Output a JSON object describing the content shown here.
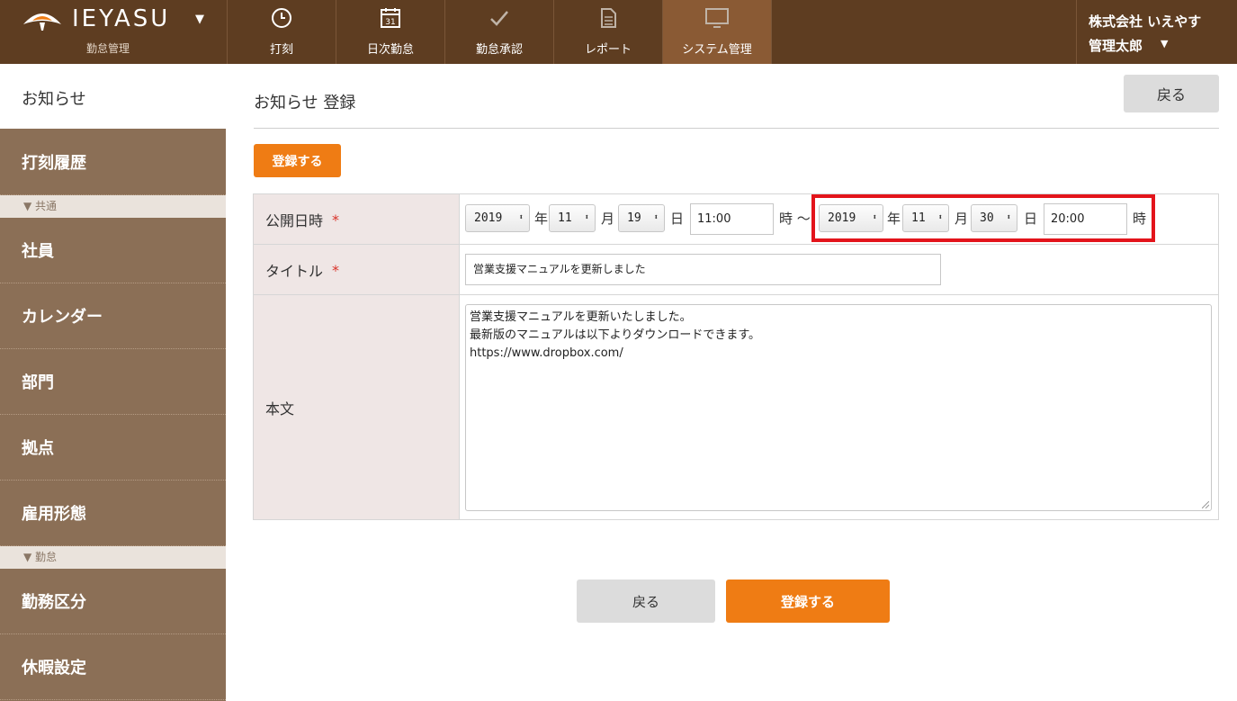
{
  "header": {
    "brand": "IEYASU",
    "brand_sub": "勤怠管理",
    "nav": [
      {
        "label": "打刻",
        "icon": "clock-icon"
      },
      {
        "label": "日次勤怠",
        "icon": "calendar-icon",
        "icon_text": "31"
      },
      {
        "label": "勤怠承認",
        "icon": "check-icon"
      },
      {
        "label": "レポート",
        "icon": "document-icon"
      },
      {
        "label": "システム管理",
        "icon": "monitor-icon",
        "active": true
      }
    ],
    "company": "株式会社 いえやす",
    "user": "管理太郎"
  },
  "sidebar": {
    "news": "お知らせ",
    "items": [
      "打刻履歴",
      "社員",
      "カレンダー",
      "部門",
      "拠点",
      "雇用形態",
      "勤務区分",
      "休暇設定"
    ],
    "sections": [
      "▼ 共通",
      "▼ 勤怠"
    ]
  },
  "main": {
    "title": "お知らせ 登録",
    "back_label": "戻る",
    "register_label": "登録する",
    "form": {
      "publish_label": "公開日時",
      "title_label": "タイトル",
      "body_label": "本文",
      "required_mark": "*",
      "start": {
        "year": "2019",
        "month": "11",
        "day": "19",
        "time": "11:00"
      },
      "end": {
        "year": "2019",
        "month": "11",
        "day": "30",
        "time": "20:00"
      },
      "units": {
        "year": "年",
        "month": "月",
        "day": "日",
        "hour": "時",
        "range_hour": "時 〜"
      },
      "title_value": "営業支援マニュアルを更新しました",
      "body_lines": [
        "営業支援マニュアルを更新いたしました。",
        "最新版のマニュアルは以下よりダウンロードできます。",
        "https://www.dropbox.com/"
      ]
    }
  },
  "colors": {
    "header_bg": "#5e3d21",
    "sidebar_bg": "#8b6f56",
    "accent_orange": "#ef7c14",
    "highlight_red": "#e3141b",
    "label_bg": "#efe6e5"
  }
}
